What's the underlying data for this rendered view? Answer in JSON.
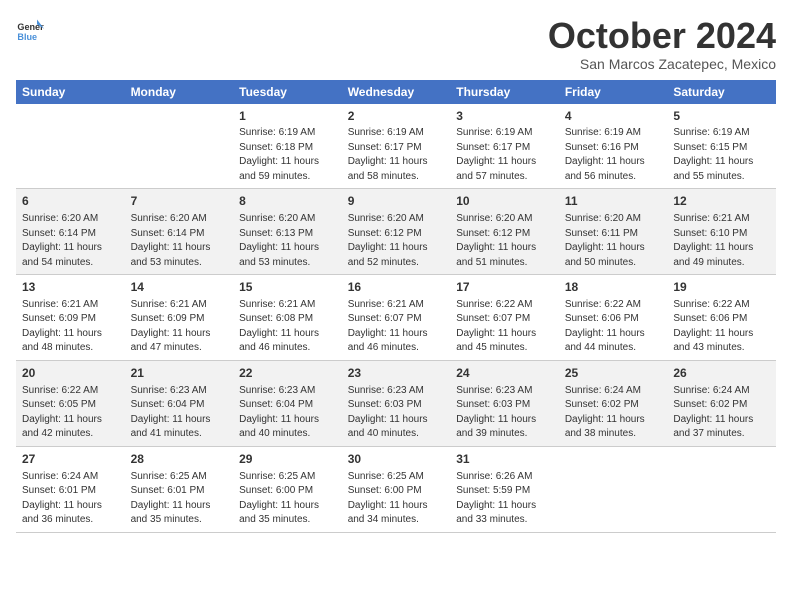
{
  "header": {
    "logo_line1": "General",
    "logo_line2": "Blue",
    "month": "October 2024",
    "location": "San Marcos Zacatepec, Mexico"
  },
  "weekdays": [
    "Sunday",
    "Monday",
    "Tuesday",
    "Wednesday",
    "Thursday",
    "Friday",
    "Saturday"
  ],
  "weeks": [
    [
      {
        "day": "",
        "content": ""
      },
      {
        "day": "",
        "content": ""
      },
      {
        "day": "1",
        "content": "Sunrise: 6:19 AM\nSunset: 6:18 PM\nDaylight: 11 hours and 59 minutes."
      },
      {
        "day": "2",
        "content": "Sunrise: 6:19 AM\nSunset: 6:17 PM\nDaylight: 11 hours and 58 minutes."
      },
      {
        "day": "3",
        "content": "Sunrise: 6:19 AM\nSunset: 6:17 PM\nDaylight: 11 hours and 57 minutes."
      },
      {
        "day": "4",
        "content": "Sunrise: 6:19 AM\nSunset: 6:16 PM\nDaylight: 11 hours and 56 minutes."
      },
      {
        "day": "5",
        "content": "Sunrise: 6:19 AM\nSunset: 6:15 PM\nDaylight: 11 hours and 55 minutes."
      }
    ],
    [
      {
        "day": "6",
        "content": "Sunrise: 6:20 AM\nSunset: 6:14 PM\nDaylight: 11 hours and 54 minutes."
      },
      {
        "day": "7",
        "content": "Sunrise: 6:20 AM\nSunset: 6:14 PM\nDaylight: 11 hours and 53 minutes."
      },
      {
        "day": "8",
        "content": "Sunrise: 6:20 AM\nSunset: 6:13 PM\nDaylight: 11 hours and 53 minutes."
      },
      {
        "day": "9",
        "content": "Sunrise: 6:20 AM\nSunset: 6:12 PM\nDaylight: 11 hours and 52 minutes."
      },
      {
        "day": "10",
        "content": "Sunrise: 6:20 AM\nSunset: 6:12 PM\nDaylight: 11 hours and 51 minutes."
      },
      {
        "day": "11",
        "content": "Sunrise: 6:20 AM\nSunset: 6:11 PM\nDaylight: 11 hours and 50 minutes."
      },
      {
        "day": "12",
        "content": "Sunrise: 6:21 AM\nSunset: 6:10 PM\nDaylight: 11 hours and 49 minutes."
      }
    ],
    [
      {
        "day": "13",
        "content": "Sunrise: 6:21 AM\nSunset: 6:09 PM\nDaylight: 11 hours and 48 minutes."
      },
      {
        "day": "14",
        "content": "Sunrise: 6:21 AM\nSunset: 6:09 PM\nDaylight: 11 hours and 47 minutes."
      },
      {
        "day": "15",
        "content": "Sunrise: 6:21 AM\nSunset: 6:08 PM\nDaylight: 11 hours and 46 minutes."
      },
      {
        "day": "16",
        "content": "Sunrise: 6:21 AM\nSunset: 6:07 PM\nDaylight: 11 hours and 46 minutes."
      },
      {
        "day": "17",
        "content": "Sunrise: 6:22 AM\nSunset: 6:07 PM\nDaylight: 11 hours and 45 minutes."
      },
      {
        "day": "18",
        "content": "Sunrise: 6:22 AM\nSunset: 6:06 PM\nDaylight: 11 hours and 44 minutes."
      },
      {
        "day": "19",
        "content": "Sunrise: 6:22 AM\nSunset: 6:06 PM\nDaylight: 11 hours and 43 minutes."
      }
    ],
    [
      {
        "day": "20",
        "content": "Sunrise: 6:22 AM\nSunset: 6:05 PM\nDaylight: 11 hours and 42 minutes."
      },
      {
        "day": "21",
        "content": "Sunrise: 6:23 AM\nSunset: 6:04 PM\nDaylight: 11 hours and 41 minutes."
      },
      {
        "day": "22",
        "content": "Sunrise: 6:23 AM\nSunset: 6:04 PM\nDaylight: 11 hours and 40 minutes."
      },
      {
        "day": "23",
        "content": "Sunrise: 6:23 AM\nSunset: 6:03 PM\nDaylight: 11 hours and 40 minutes."
      },
      {
        "day": "24",
        "content": "Sunrise: 6:23 AM\nSunset: 6:03 PM\nDaylight: 11 hours and 39 minutes."
      },
      {
        "day": "25",
        "content": "Sunrise: 6:24 AM\nSunset: 6:02 PM\nDaylight: 11 hours and 38 minutes."
      },
      {
        "day": "26",
        "content": "Sunrise: 6:24 AM\nSunset: 6:02 PM\nDaylight: 11 hours and 37 minutes."
      }
    ],
    [
      {
        "day": "27",
        "content": "Sunrise: 6:24 AM\nSunset: 6:01 PM\nDaylight: 11 hours and 36 minutes."
      },
      {
        "day": "28",
        "content": "Sunrise: 6:25 AM\nSunset: 6:01 PM\nDaylight: 11 hours and 35 minutes."
      },
      {
        "day": "29",
        "content": "Sunrise: 6:25 AM\nSunset: 6:00 PM\nDaylight: 11 hours and 35 minutes."
      },
      {
        "day": "30",
        "content": "Sunrise: 6:25 AM\nSunset: 6:00 PM\nDaylight: 11 hours and 34 minutes."
      },
      {
        "day": "31",
        "content": "Sunrise: 6:26 AM\nSunset: 5:59 PM\nDaylight: 11 hours and 33 minutes."
      },
      {
        "day": "",
        "content": ""
      },
      {
        "day": "",
        "content": ""
      }
    ]
  ]
}
